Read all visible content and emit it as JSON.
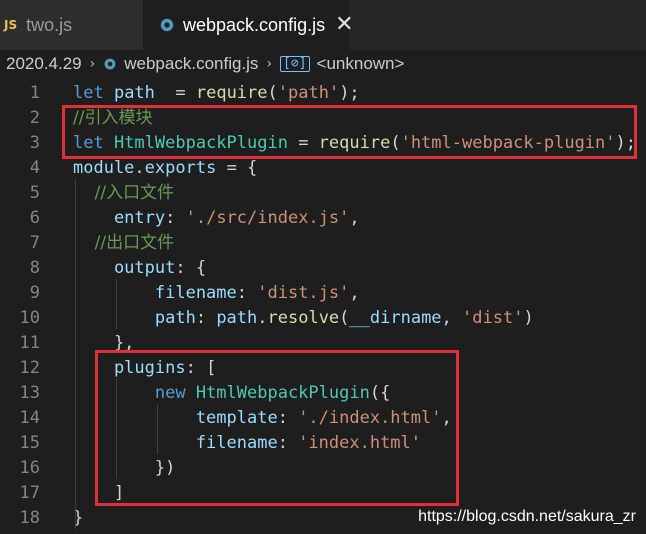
{
  "tabs": [
    {
      "label": "two.js",
      "icon": "js-icon",
      "icon_text": "JS",
      "active": false
    },
    {
      "label": "webpack.config.js",
      "icon": "gear-icon",
      "active": true,
      "close": "✕"
    }
  ],
  "breadcrumb": {
    "folder": "2020.4.29",
    "file": "webpack.config.js",
    "symbol_icon": "[⊘]",
    "symbol": "<unknown>",
    "separator": "›"
  },
  "code_lines": [
    {
      "n": "1",
      "tokens": [
        [
          "kw",
          "let "
        ],
        [
          "var",
          "path"
        ],
        [
          "",
          "  = "
        ],
        [
          "fn",
          "require"
        ],
        [
          "",
          "("
        ],
        [
          "str",
          "'path'"
        ],
        [
          "",
          ");"
        ]
      ]
    },
    {
      "n": "2",
      "tokens": [
        [
          "cmt",
          "//引入模块"
        ]
      ]
    },
    {
      "n": "3",
      "tokens": [
        [
          "kw",
          "let "
        ],
        [
          "cls",
          "HtmlWebpackPlugin"
        ],
        [
          "",
          " = "
        ],
        [
          "fn",
          "require"
        ],
        [
          "",
          "("
        ],
        [
          "str",
          "'html-webpack-plugin'"
        ],
        [
          "",
          ");"
        ]
      ]
    },
    {
      "n": "4",
      "tokens": [
        [
          "var",
          "module"
        ],
        [
          "",
          "."
        ],
        [
          "var",
          "exports"
        ],
        [
          "",
          " = {"
        ]
      ]
    },
    {
      "n": "5",
      "tokens": [
        [
          "cmt",
          "    //入口文件"
        ]
      ]
    },
    {
      "n": "6",
      "tokens": [
        [
          "var",
          "    entry"
        ],
        [
          "",
          ": "
        ],
        [
          "str",
          "'./src/index.js'"
        ],
        [
          "",
          ","
        ]
      ]
    },
    {
      "n": "7",
      "tokens": [
        [
          "cmt",
          "    //出口文件"
        ]
      ]
    },
    {
      "n": "8",
      "tokens": [
        [
          "var",
          "    output"
        ],
        [
          "",
          ": {"
        ]
      ]
    },
    {
      "n": "9",
      "tokens": [
        [
          "var",
          "        filename"
        ],
        [
          "",
          ": "
        ],
        [
          "str",
          "'dist.js'"
        ],
        [
          "",
          ","
        ]
      ]
    },
    {
      "n": "10",
      "tokens": [
        [
          "var",
          "        path"
        ],
        [
          "",
          ": "
        ],
        [
          "var",
          "path"
        ],
        [
          "",
          "."
        ],
        [
          "fn",
          "resolve"
        ],
        [
          "",
          "("
        ],
        [
          "var",
          "__dirname"
        ],
        [
          "",
          ", "
        ],
        [
          "str",
          "'dist'"
        ],
        [
          "",
          ")"
        ]
      ]
    },
    {
      "n": "11",
      "tokens": [
        [
          "",
          "    },"
        ]
      ]
    },
    {
      "n": "12",
      "tokens": [
        [
          "var",
          "    plugins"
        ],
        [
          "",
          ": ["
        ]
      ]
    },
    {
      "n": "13",
      "tokens": [
        [
          "kw",
          "        new "
        ],
        [
          "cls",
          "HtmlWebpackPlugin"
        ],
        [
          "",
          "({"
        ]
      ]
    },
    {
      "n": "14",
      "tokens": [
        [
          "var",
          "            template"
        ],
        [
          "",
          ": "
        ],
        [
          "str",
          "'./index.html'"
        ],
        [
          "",
          ","
        ]
      ]
    },
    {
      "n": "15",
      "tokens": [
        [
          "var",
          "            filename"
        ],
        [
          "",
          ": "
        ],
        [
          "str",
          "'index.html'"
        ]
      ]
    },
    {
      "n": "16",
      "tokens": [
        [
          "",
          "        })"
        ]
      ]
    },
    {
      "n": "17",
      "tokens": [
        [
          "",
          "    ]"
        ]
      ]
    },
    {
      "n": "18",
      "tokens": [
        [
          "",
          "}"
        ]
      ]
    }
  ],
  "watermark": "https://blog.csdn.net/sakura_zr",
  "colors": {
    "accent": "#e0303a",
    "keyword": "#569cd6",
    "string": "#ce9178",
    "comment": "#6a9955"
  }
}
